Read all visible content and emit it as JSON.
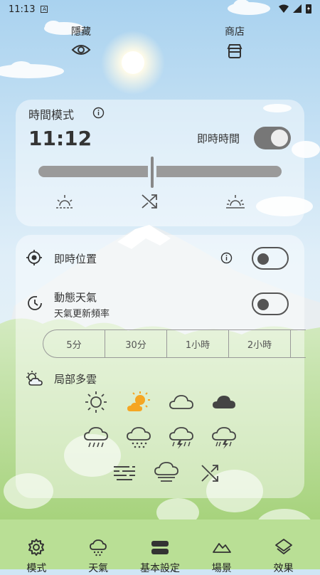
{
  "status_bar": {
    "time": "11:13"
  },
  "top": {
    "hide_label": "隱藏",
    "store_label": "商店"
  },
  "time_panel": {
    "title": "時間模式",
    "current_time": "11:12",
    "realtime_label": "即時時間",
    "realtime_toggle": "on"
  },
  "settings": {
    "location_label": "即時位置",
    "location_toggle": "off",
    "dynamic_weather_label": "動態天氣",
    "dynamic_weather_sub": "天氣更新頻率",
    "dynamic_weather_toggle": "off",
    "frequencies": [
      "5分",
      "30分",
      "1小時",
      "2小時"
    ],
    "current_weather": "局部多雲"
  },
  "nav": {
    "items": [
      {
        "label": "模式",
        "icon": "gear-icon"
      },
      {
        "label": "天氣",
        "icon": "weather-icon"
      },
      {
        "label": "基本設定",
        "icon": "settings-toggles-icon"
      },
      {
        "label": "場景",
        "icon": "mountain-icon"
      },
      {
        "label": "效果",
        "icon": "layers-icon"
      }
    ]
  },
  "colors": {
    "sun_accent": "#f5a623",
    "sky": "#bcdcf2",
    "grass": "#a8d67a"
  }
}
